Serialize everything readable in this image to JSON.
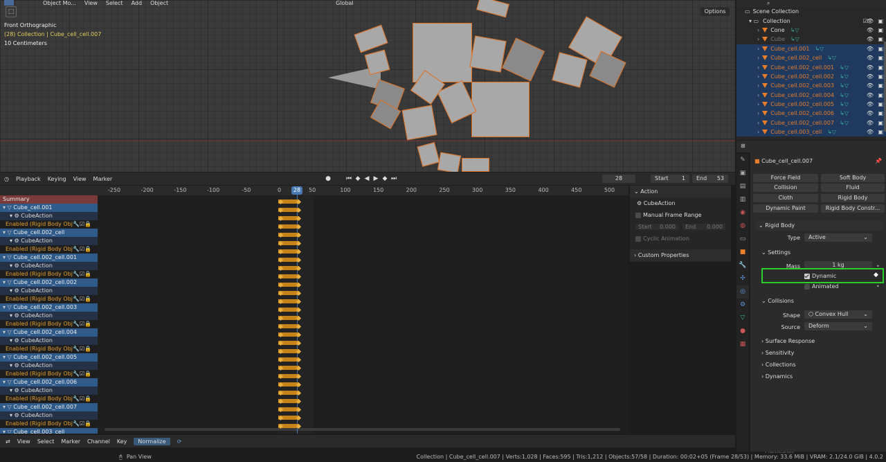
{
  "viewport": {
    "menu": [
      "View",
      "Select",
      "Add",
      "Object"
    ],
    "mode_label": "Object Mo...",
    "transform": "Global",
    "view_name": "Front Orthographic",
    "collection_line": "(28) Collection | Cube_cell_cell.007",
    "scale_label": "10 Centimeters",
    "options_label": "Options"
  },
  "timeline": {
    "menus": [
      "Playback",
      "Keying",
      "View",
      "Marker"
    ],
    "current_frame": "28",
    "start_label": "Start",
    "start_value": "1",
    "end_label": "End",
    "end_value": "53"
  },
  "dopesheet": {
    "ruler_ticks": [
      "-250",
      "-200",
      "-150",
      "-100",
      "-50",
      "0",
      "50",
      "100",
      "150",
      "200",
      "250",
      "300",
      "350",
      "400",
      "450",
      "500"
    ],
    "summary": "Summary",
    "objects": [
      {
        "name": "Cube_cell.001",
        "action": "CubeAction",
        "channel": "Enabled (Rigid Body Obj"
      },
      {
        "name": "Cube_cell.002_cell",
        "action": "CubeAction",
        "channel": "Enabled (Rigid Body Obj"
      },
      {
        "name": "Cube_cell.002_cell.001",
        "action": "CubeAction",
        "channel": "Enabled (Rigid Body Obj"
      },
      {
        "name": "Cube_cell.002_cell.002",
        "action": "CubeAction",
        "channel": "Enabled (Rigid Body Obj"
      },
      {
        "name": "Cube_cell.002_cell.003",
        "action": "CubeAction",
        "channel": "Enabled (Rigid Body Obj"
      },
      {
        "name": "Cube_cell.002_cell.004",
        "action": "CubeAction",
        "channel": "Enabled (Rigid Body Obj"
      },
      {
        "name": "Cube_cell.002_cell.005",
        "action": "CubeAction",
        "channel": "Enabled (Rigid Body Obj"
      },
      {
        "name": "Cube_cell.002_cell.006",
        "action": "CubeAction",
        "channel": "Enabled (Rigid Body Obj"
      },
      {
        "name": "Cube_cell.002_cell.007",
        "action": "CubeAction",
        "channel": "Enabled (Rigid Body Obj"
      }
    ],
    "last_partial": "Cube_cell.003_cell",
    "footer_menus": [
      "View",
      "Select",
      "Marker",
      "Channel",
      "Key"
    ],
    "normalize_label": "Normalize"
  },
  "action_panel": {
    "header": "Action",
    "action_name": "CubeAction",
    "manual_range": "Manual Frame Range",
    "start_label": "Start",
    "start_value": "0.000",
    "end_label": "End",
    "end_value": "0.000",
    "cyclic": "Cyclic Animation",
    "custom_props": "Custom Properties"
  },
  "outliner": {
    "scene": "Scene Collection",
    "collection": "Collection",
    "items": [
      {
        "name": "Cone",
        "style": "wh",
        "sel": false
      },
      {
        "name": "Cube",
        "style": "dim",
        "sel": false
      },
      {
        "name": "Cube_cell.001",
        "style": "or",
        "sel": true
      },
      {
        "name": "Cube_cell.002_cell",
        "style": "or",
        "sel": true
      },
      {
        "name": "Cube_cell.002_cell.001",
        "style": "or",
        "sel": true
      },
      {
        "name": "Cube_cell.002_cell.002",
        "style": "or",
        "sel": true
      },
      {
        "name": "Cube_cell.002_cell.003",
        "style": "or",
        "sel": true
      },
      {
        "name": "Cube_cell.002_cell.004",
        "style": "or",
        "sel": true
      },
      {
        "name": "Cube_cell.002_cell.005",
        "style": "or",
        "sel": true
      },
      {
        "name": "Cube_cell.002_cell.006",
        "style": "or",
        "sel": true
      },
      {
        "name": "Cube_cell.002_cell.007",
        "style": "or",
        "sel": true
      },
      {
        "name": "Cube_cell.003_cell",
        "style": "or",
        "sel": true
      }
    ]
  },
  "properties": {
    "object_name": "Cube_cell_cell.007",
    "physics_buttons": [
      "Force Field",
      "Soft Body",
      "Collision",
      "Fluid",
      "Cloth",
      "Rigid Body",
      "Dynamic Paint",
      "Rigid Body Constr..."
    ],
    "rigid_body": "Rigid Body",
    "type_label": "Type",
    "type_value": "Active",
    "settings": "Settings",
    "mass_label": "Mass",
    "mass_value": "1 kg",
    "dynamic_label": "Dynamic",
    "animated_label": "Animated",
    "collisions": "Collisions",
    "shape_label": "Shape",
    "shape_value": "Convex Hull",
    "source_label": "Source",
    "source_value": "Deform",
    "surface_response": "Surface Response",
    "sensitivity": "Sensitivity",
    "collections": "Collections",
    "dynamics": "Dynamics"
  },
  "status": {
    "pan_view": "Pan View",
    "info": "Collection | Cube_cell_cell.007 | Verts:1,028 | Faces:595 | Tris:1,212 | Objects:57/58 | Duration: 00:02+05 (Frame 28/53) | Memory: 33.6 MiB | VRAM: 2.1/24.0 GiB | 4.0.2",
    "watermark": "Flameshot"
  }
}
